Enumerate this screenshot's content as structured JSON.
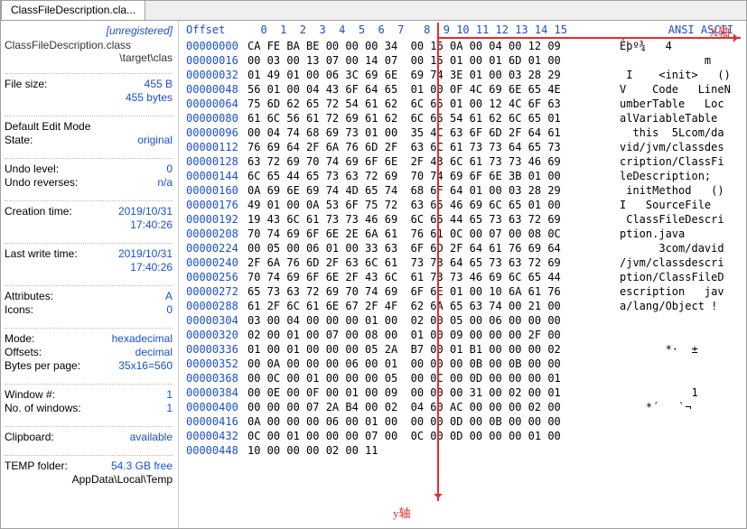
{
  "tab_title": "ClassFileDescription.cla...",
  "registration": "[unregistered]",
  "path_line1": "ClassFileDescription.class",
  "path_line2": "                \\target\\clas",
  "info": {
    "file_size_k": "File size:",
    "file_size_v1": "455 B",
    "file_size_v2": "455 bytes",
    "edit_mode_k": "Default Edit Mode",
    "state_k": "State:",
    "state_v": "original",
    "undo_level_k": "Undo level:",
    "undo_level_v": "0",
    "undo_rev_k": "Undo reverses:",
    "undo_rev_v": "n/a",
    "ctime_k": "Creation time:",
    "ctime_v1": "2019/10/31",
    "ctime_v2": "17:40:26",
    "wtime_k": "Last write time:",
    "wtime_v1": "2019/10/31",
    "wtime_v2": "17:40:26",
    "attr_k": "Attributes:",
    "attr_v": "A",
    "icons_k": "Icons:",
    "icons_v": "0",
    "mode_k": "Mode:",
    "mode_v": "hexadecimal",
    "offsets_k": "Offsets:",
    "offsets_v": "decimal",
    "bpp_k": "Bytes per page:",
    "bpp_v": "35x16=560",
    "winno_k": "Window #:",
    "winno_v": "1",
    "nowin_k": "No. of windows:",
    "nowin_v": "1",
    "clip_k": "Clipboard:",
    "clip_v": "available",
    "temp_k": "TEMP folder:",
    "temp_v": "54.3 GB free",
    "temp_path": "          AppData\\Local\\Temp"
  },
  "hdr_offset": "Offset",
  "hdr_cols": "  0  1  2  3  4  5  6  7   8  9 10 11 12 13 14 15",
  "hdr_ascii": "ANSI ASCII",
  "x_axis": "X轴",
  "y_axis": "y轴",
  "rows": [
    {
      "o": "00000000",
      "b": "CA FE BA BE 00 00 00 34  00 16 0A 00 04 00 12 09",
      "a": "Êþº¾   4"
    },
    {
      "o": "00000016",
      "b": "00 03 00 13 07 00 14 07  00 15 01 00 01 6D 01 00",
      "a": "             m"
    },
    {
      "o": "00000032",
      "b": "01 49 01 00 06 3C 69 6E  69 74 3E 01 00 03 28 29",
      "a": " I    <init>   ()"
    },
    {
      "o": "00000048",
      "b": "56 01 00 04 43 6F 64 65  01 00 0F 4C 69 6E 65 4E",
      "a": "V    Code   LineN"
    },
    {
      "o": "00000064",
      "b": "75 6D 62 65 72 54 61 62  6C 65 01 00 12 4C 6F 63",
      "a": "umberTable   Loc"
    },
    {
      "o": "00000080",
      "b": "61 6C 56 61 72 69 61 62  6C 65 54 61 62 6C 65 01",
      "a": "alVariableTable"
    },
    {
      "o": "00000096",
      "b": "00 04 74 68 69 73 01 00  35 4C 63 6F 6D 2F 64 61",
      "a": "  this  5Lcom/da"
    },
    {
      "o": "00000112",
      "b": "76 69 64 2F 6A 76 6D 2F  63 6C 61 73 73 64 65 73",
      "a": "vid/jvm/classdes"
    },
    {
      "o": "00000128",
      "b": "63 72 69 70 74 69 6F 6E  2F 43 6C 61 73 73 46 69",
      "a": "cription/ClassFi"
    },
    {
      "o": "00000144",
      "b": "6C 65 44 65 73 63 72 69  70 74 69 6F 6E 3B 01 00",
      "a": "leDescription;"
    },
    {
      "o": "00000160",
      "b": "0A 69 6E 69 74 4D 65 74  68 6F 64 01 00 03 28 29",
      "a": " initMethod   ()"
    },
    {
      "o": "00000176",
      "b": "49 01 00 0A 53 6F 75 72  63 65 46 69 6C 65 01 00",
      "a": "I   SourceFile"
    },
    {
      "o": "00000192",
      "b": "19 43 6C 61 73 73 46 69  6C 65 44 65 73 63 72 69",
      "a": " ClassFileDescri"
    },
    {
      "o": "00000208",
      "b": "70 74 69 6F 6E 2E 6A 61  76 61 0C 00 07 00 08 0C",
      "a": "ption.java"
    },
    {
      "o": "00000224",
      "b": "00 05 00 06 01 00 33 63  6F 6D 2F 64 61 76 69 64",
      "a": "      3com/david"
    },
    {
      "o": "00000240",
      "b": "2F 6A 76 6D 2F 63 6C 61  73 73 64 65 73 63 72 69",
      "a": "/jvm/classdescri"
    },
    {
      "o": "00000256",
      "b": "70 74 69 6F 6E 2F 43 6C  61 73 73 46 69 6C 65 44",
      "a": "ption/ClassFileD"
    },
    {
      "o": "00000272",
      "b": "65 73 63 72 69 70 74 69  6F 6E 01 00 10 6A 61 76",
      "a": "escription   jav"
    },
    {
      "o": "00000288",
      "b": "61 2F 6C 61 6E 67 2F 4F  62 6A 65 63 74 00 21 00",
      "a": "a/lang/Object !"
    },
    {
      "o": "00000304",
      "b": "03 00 04 00 00 00 01 00  02 00 05 00 06 00 00 00",
      "a": ""
    },
    {
      "o": "00000320",
      "b": "02 00 01 00 07 00 08 00  01 00 09 00 00 00 2F 00",
      "a": ""
    },
    {
      "o": "00000336",
      "b": "01 00 01 00 00 00 05 2A  B7 00 01 B1 00 00 00 02",
      "a": "       *·  ±"
    },
    {
      "o": "00000352",
      "b": "00 0A 00 00 00 06 00 01  00 00 00 0B 00 0B 00 00",
      "a": ""
    },
    {
      "o": "00000368",
      "b": "00 0C 00 01 00 00 00 05  00 0C 00 0D 00 00 00 01",
      "a": ""
    },
    {
      "o": "00000384",
      "b": "00 0E 00 0F 00 01 00 09  00 00 00 31 00 02 00 01",
      "a": "           1"
    },
    {
      "o": "00000400",
      "b": "00 00 00 07 2A B4 00 02  04 60 AC 00 00 00 02 00",
      "a": "    *´   `¬"
    },
    {
      "o": "00000416",
      "b": "0A 00 00 00 06 00 01 00  00 00 0D 00 0B 00 00 00",
      "a": ""
    },
    {
      "o": "00000432",
      "b": "0C 00 01 00 00 00 07 00  0C 00 0D 00 00 00 01 00",
      "a": ""
    },
    {
      "o": "00000448",
      "b": "10 00 00 00 02 00 11",
      "a": ""
    }
  ]
}
